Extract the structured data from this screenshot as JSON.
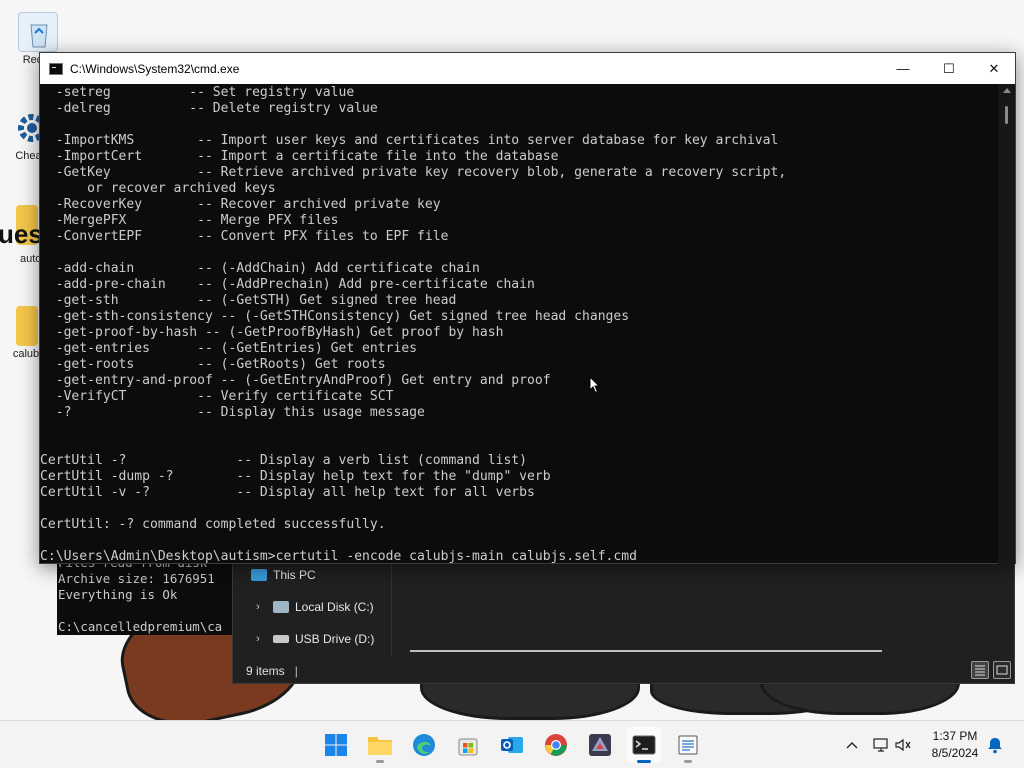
{
  "desktop": {
    "icons": [
      {
        "label": "Recyc"
      },
      {
        "label": "Cheat"
      },
      {
        "label": "ues"
      },
      {
        "label": "auto"
      },
      {
        "label": "calubjs"
      }
    ]
  },
  "background_cmd": {
    "lines": [
      "Files read from disk",
      "Archive size: 1676951",
      "Everything is Ok",
      "",
      "C:\\cancelledpremium\\ca"
    ]
  },
  "explorer": {
    "nav_items": [
      {
        "label": "This PC",
        "icon": "this-pc-icon"
      },
      {
        "label": "Local Disk (C:)",
        "icon": "local-disk-icon"
      },
      {
        "label": "USB Drive (D:)",
        "icon": "usb-drive-icon"
      }
    ],
    "status": "9 items",
    "status_sep": "|"
  },
  "cmd": {
    "title": "C:\\Windows\\System32\\cmd.exe",
    "minimize_glyph": "—",
    "maximize_glyph": "☐",
    "close_glyph": "✕",
    "lines": [
      "  -setreg          -- Set registry value",
      "  -delreg          -- Delete registry value",
      "",
      "  -ImportKMS        -- Import user keys and certificates into server database for key archival",
      "  -ImportCert       -- Import a certificate file into the database",
      "  -GetKey           -- Retrieve archived private key recovery blob, generate a recovery script,",
      "      or recover archived keys",
      "  -RecoverKey       -- Recover archived private key",
      "  -MergePFX         -- Merge PFX files",
      "  -ConvertEPF       -- Convert PFX files to EPF file",
      "",
      "  -add-chain        -- (-AddChain) Add certificate chain",
      "  -add-pre-chain    -- (-AddPrechain) Add pre-certificate chain",
      "  -get-sth          -- (-GetSTH) Get signed tree head",
      "  -get-sth-consistency -- (-GetSTHConsistency) Get signed tree head changes",
      "  -get-proof-by-hash -- (-GetProofByHash) Get proof by hash",
      "  -get-entries      -- (-GetEntries) Get entries",
      "  -get-roots        -- (-GetRoots) Get roots",
      "  -get-entry-and-proof -- (-GetEntryAndProof) Get entry and proof",
      "  -VerifyCT         -- Verify certificate SCT",
      "  -?                -- Display this usage message",
      "",
      "",
      "CertUtil -?              -- Display a verb list (command list)",
      "CertUtil -dump -?        -- Display help text for the \"dump\" verb",
      "CertUtil -v -?           -- Display all help text for all verbs",
      "",
      "CertUtil: -? command completed successfully.",
      "",
      "C:\\Users\\Admin\\Desktop\\autism>certutil -encode calubjs-main calubjs.self.cmd"
    ]
  },
  "taskbar": {
    "apps": [
      {
        "name": "start",
        "icon": "windows-start-icon"
      },
      {
        "name": "file-explorer",
        "icon": "folder-icon"
      },
      {
        "name": "edge",
        "icon": "edge-icon"
      },
      {
        "name": "store",
        "icon": "store-icon"
      },
      {
        "name": "outlook",
        "icon": "outlook-icon"
      },
      {
        "name": "chrome",
        "icon": "chrome-icon"
      },
      {
        "name": "game",
        "icon": "game-app-icon"
      },
      {
        "name": "terminal",
        "icon": "terminal-icon"
      },
      {
        "name": "notepad",
        "icon": "notepad-icon"
      }
    ],
    "time": "1:37 PM",
    "date": "8/5/2024"
  },
  "colors": {
    "console_bg": "#0c0c0c",
    "console_text": "#cccccc",
    "accent": "#0067c0"
  }
}
